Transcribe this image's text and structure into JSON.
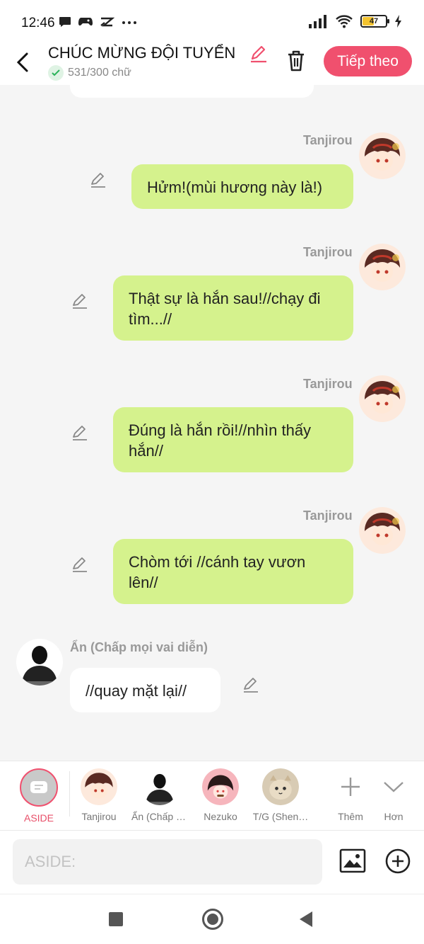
{
  "status_bar": {
    "time": "12:46",
    "battery": "47"
  },
  "header": {
    "title": "CHÚC MỪNG ĐỘI TUYỂN",
    "word_count": "531/300 chữ",
    "next_button": "Tiếp theo"
  },
  "messages": [
    {
      "speaker": "Tanjirou",
      "text": "Hửm!(mùi hương này là!)"
    },
    {
      "speaker": "Tanjirou",
      "text": "Thật sự là hắn sau!//chạy đi tìm...//"
    },
    {
      "speaker": "Tanjirou",
      "text": "Đúng là hắn rồi!//nhìn thấy hắn//"
    },
    {
      "speaker": "Tanjirou",
      "text": "Chòm tới //cánh tay vươn lên//"
    },
    {
      "speaker": "Ẩn (Chấp mọi vai diễn)",
      "text": "//quay mặt lại//"
    }
  ],
  "character_bar": {
    "aside": "ASIDE",
    "characters": [
      "Tanjirou",
      "Ẩn (Chấp mọi vai diễn)",
      "Nezuko",
      "T/G (Shen…"
    ],
    "more_label": "Thêm",
    "collapse_label": "Hơn"
  },
  "input": {
    "placeholder": "ASIDE:"
  },
  "colors": {
    "accent": "#f0506e",
    "bubble_green": "#d5f28d",
    "background": "#f5f5f5"
  }
}
